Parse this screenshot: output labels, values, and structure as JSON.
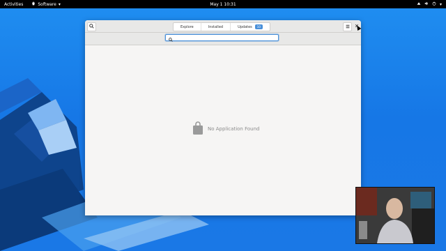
{
  "topbar": {
    "activities": "Activities",
    "app_name": "Software",
    "clock": "May 1  10:31"
  },
  "window": {
    "tabs": [
      {
        "label": "Explore"
      },
      {
        "label": "Installed"
      },
      {
        "label": "Updates",
        "badge": "10"
      }
    ],
    "search": {
      "value": "",
      "placeholder": ""
    },
    "empty_message": "No Application Found"
  },
  "colors": {
    "accent": "#4a90d9",
    "desktop": "#1a78e6",
    "topbar": "#000000"
  },
  "icons": {
    "search": "search-icon",
    "menu": "hamburger-menu-icon",
    "close": "close-icon",
    "empty": "shopping-bag-icon"
  }
}
